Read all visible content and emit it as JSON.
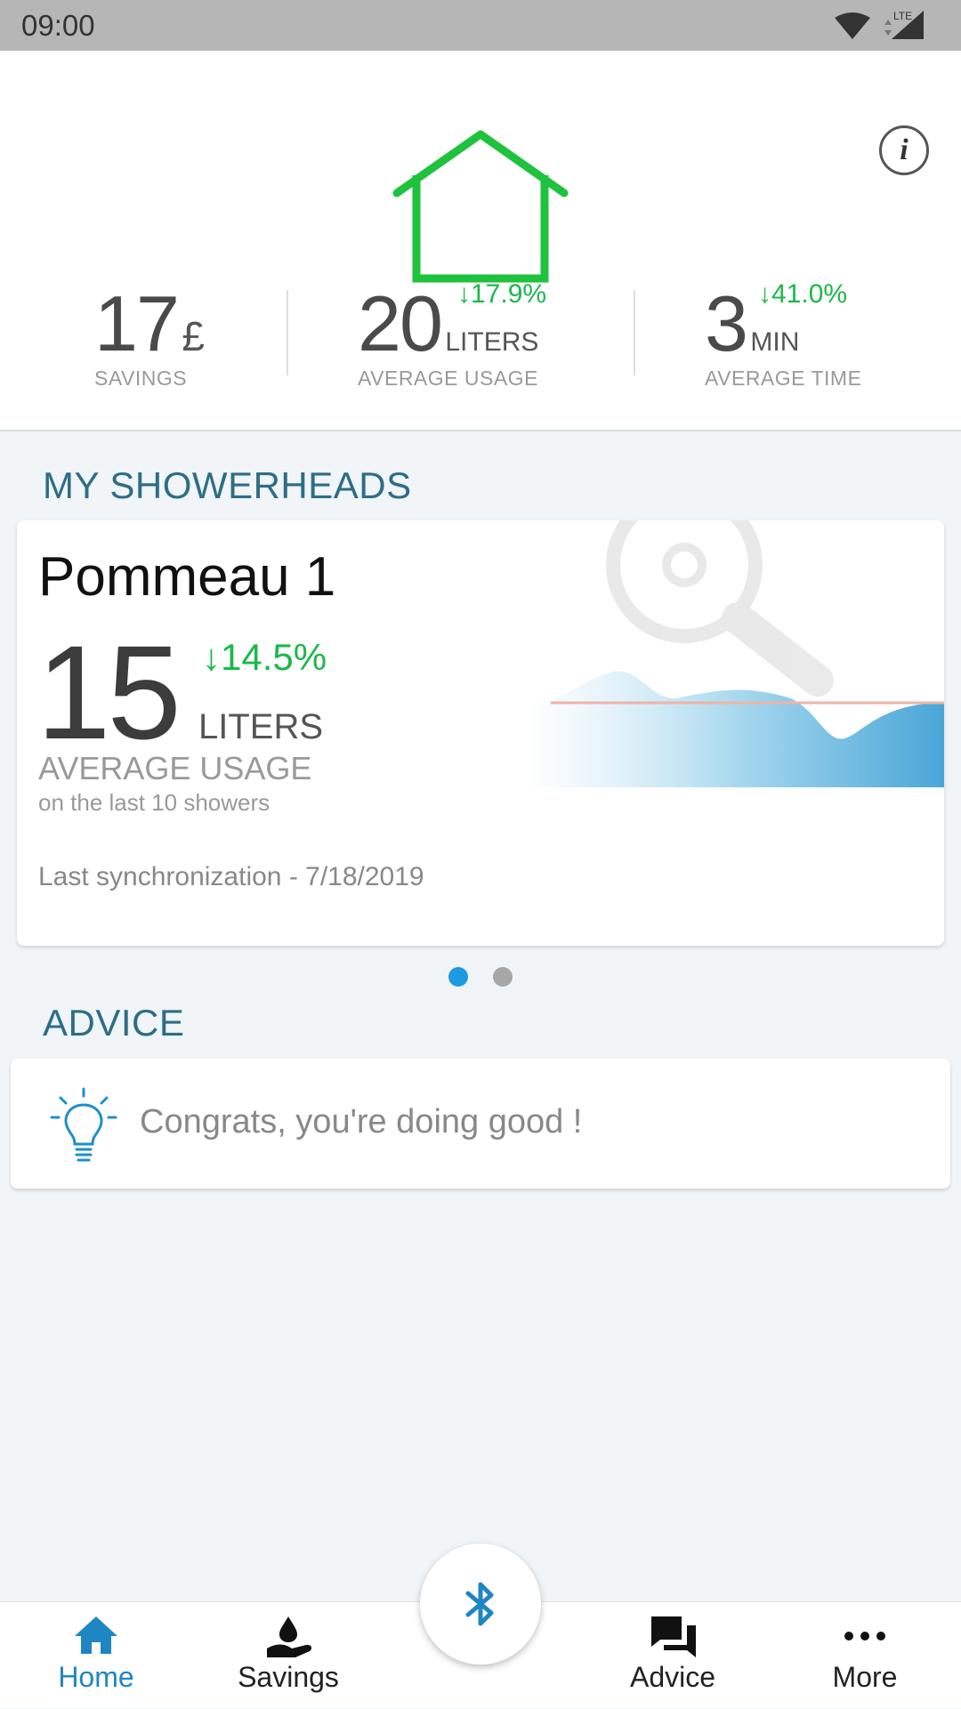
{
  "status_bar": {
    "time": "09:00",
    "network_label": "LTE"
  },
  "header": {
    "stats": [
      {
        "value": "17",
        "unit": "£",
        "label": "SAVINGS"
      },
      {
        "value": "20",
        "unit": "LITERS",
        "change": "17.9%",
        "label": "AVERAGE USAGE"
      },
      {
        "value": "3",
        "unit": "MIN",
        "change": "41.0%",
        "label": "AVERAGE TIME"
      }
    ]
  },
  "showerheads": {
    "title": "MY SHOWERHEADS",
    "card": {
      "name": "Pommeau 1",
      "value": "15",
      "change": "14.5%",
      "unit": "LITERS",
      "label": "AVERAGE USAGE",
      "sub_label": "on the last 10 showers",
      "sync": "Last synchronization - 7/18/2019"
    },
    "page_count": 2,
    "active_page": 1
  },
  "advice": {
    "title": "ADVICE",
    "text": "Congrats, you're doing good !"
  },
  "nav": {
    "items": [
      {
        "label": "Home",
        "icon": "home-icon",
        "active": true
      },
      {
        "label": "Savings",
        "icon": "savings-icon",
        "active": false
      },
      {
        "label": "Advice",
        "icon": "chat-icon",
        "active": false
      },
      {
        "label": "More",
        "icon": "more-icon",
        "active": false
      }
    ],
    "center_icon": "bluetooth-icon"
  },
  "colors": {
    "accent": "#1f86c4",
    "positive": "#1cb84a",
    "section_title": "#2e6d86",
    "house": "#1ec23c"
  }
}
